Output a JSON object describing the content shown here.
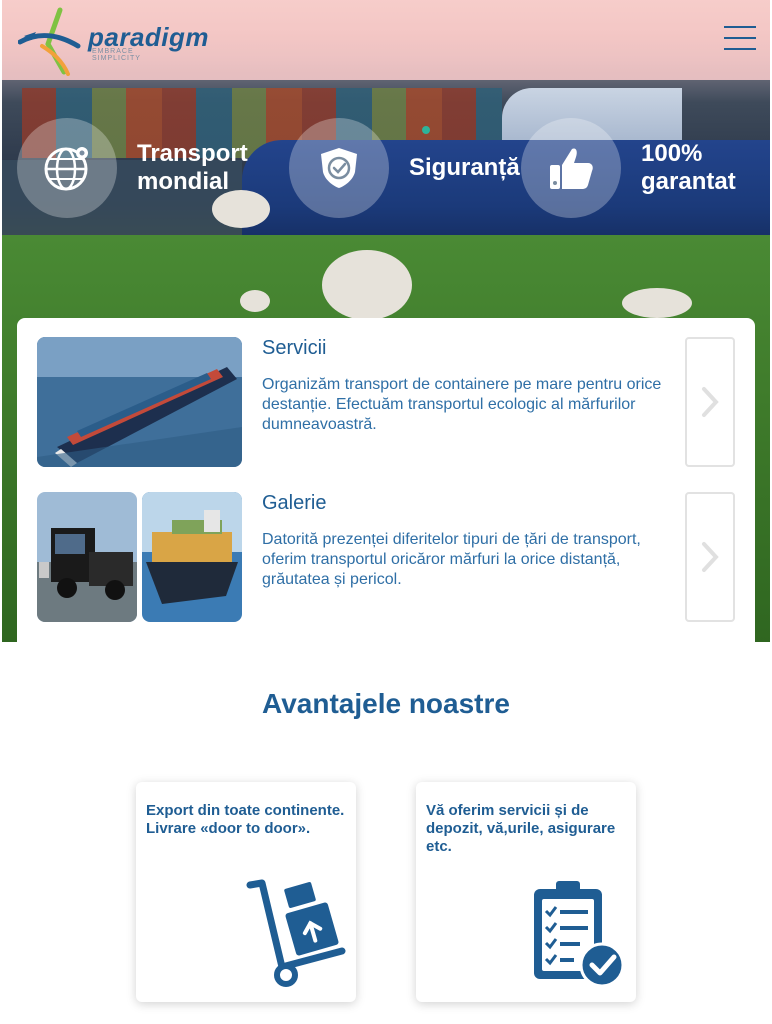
{
  "header": {
    "logo_word": "paradigm",
    "logo_tagline": "EMBRACE SIMPLICITY",
    "menu_icon": "hamburger-menu-icon"
  },
  "features": [
    {
      "label": "Transport\nmondial",
      "icon": "globe-icon"
    },
    {
      "label": "Siguranță",
      "icon": "shield-check-icon"
    },
    {
      "label": "100%\ngarantat",
      "icon": "thumbs-up-icon"
    }
  ],
  "services": [
    {
      "title": "Servicii",
      "text": "Organizăm transport de containere pe mare pentru orice destanție. Efectuăm transportul ecologic al mărfurilor dumneavoastră.",
      "icon": "chevron-right-icon"
    },
    {
      "title": "Galerie",
      "text": "Datorită prezenței diferitelor tipuri de țări de transport, oferim transportul oricăror mărfuri la orice distanță, grăutatea și pericol.",
      "icon": "chevron-right-icon"
    }
  ],
  "advantages": {
    "title": "Avantajele noastre",
    "cards": [
      {
        "text": "Export din toate continente. Livrare «door to door».",
        "icon": "hand-truck-icon"
      },
      {
        "text": "Vă oferim servicii și de depozit, vă,urile, asigurare etc.",
        "icon": "clipboard-check-icon"
      }
    ]
  },
  "colors": {
    "brand_blue": "#1f5d93",
    "text_blue": "#2f6fa6",
    "accent_green": "#2db39a"
  }
}
